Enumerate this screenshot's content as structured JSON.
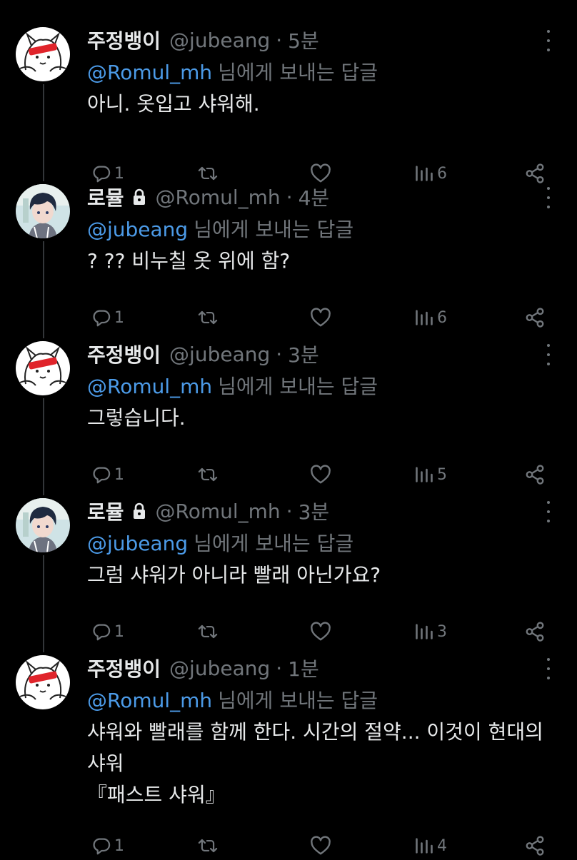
{
  "tweets": [
    {
      "name": "주정뱅이",
      "handle": "@jubeang",
      "time": "5분",
      "locked": false,
      "avatar": "drawn-cat-avatar",
      "reply_mention": "@Romul_mh",
      "reply_suffix": "님에게 보내는 답글",
      "lines": [
        "아니. 옷입고 샤워해."
      ],
      "replies": "1",
      "views": "6"
    },
    {
      "name": "로뮬",
      "handle": "@Romul_mh",
      "time": "4분",
      "locked": true,
      "avatar": "anime-boy-avatar",
      "reply_mention": "@jubeang",
      "reply_suffix": "님에게 보내는 답글",
      "lines": [
        "? ?? 비누칠 옷 위에 함?"
      ],
      "replies": "1",
      "views": "6"
    },
    {
      "name": "주정뱅이",
      "handle": "@jubeang",
      "time": "3분",
      "locked": false,
      "avatar": "drawn-cat-avatar",
      "reply_mention": "@Romul_mh",
      "reply_suffix": "님에게 보내는 답글",
      "lines": [
        "그렇습니다."
      ],
      "replies": "1",
      "views": "5"
    },
    {
      "name": "로뮬",
      "handle": "@Romul_mh",
      "time": "3분",
      "locked": true,
      "avatar": "anime-boy-avatar",
      "reply_mention": "@jubeang",
      "reply_suffix": "님에게 보내는 답글",
      "lines": [
        "그럼 샤워가 아니라 빨래 아닌가요?"
      ],
      "replies": "1",
      "views": "3"
    },
    {
      "name": "주정뱅이",
      "handle": "@jubeang",
      "time": "1분",
      "locked": false,
      "avatar": "drawn-cat-avatar",
      "reply_mention": "@Romul_mh",
      "reply_suffix": "님에게 보내는 답글",
      "lines": [
        "샤워와 빨래를 함께 한다. 시간의 절약... 이것이 현대의",
        "샤워",
        "『패스트 샤워』"
      ],
      "replies": "1",
      "views": "4"
    }
  ],
  "colors": {
    "background": "#000000",
    "text": "#e7e9ea",
    "muted": "#71767b",
    "mention": "#4c9be8"
  }
}
